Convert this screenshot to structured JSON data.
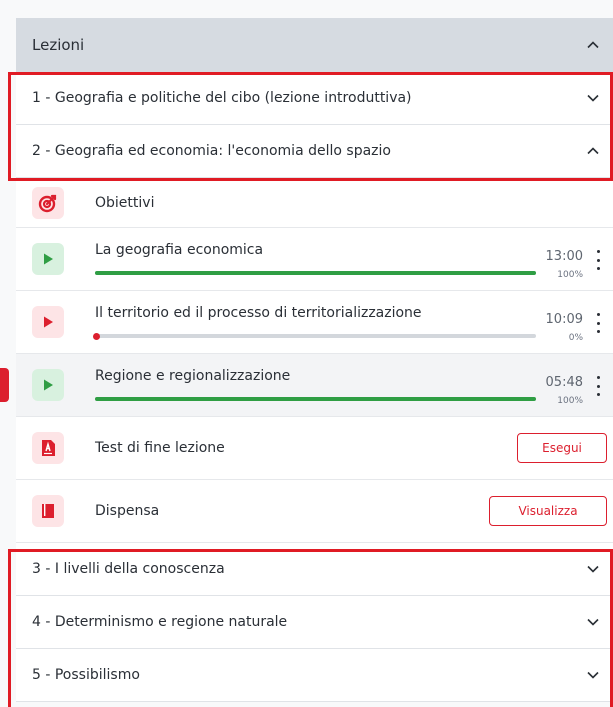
{
  "header": {
    "title": "Lezioni"
  },
  "sections": [
    {
      "label": "1 - Geografia e politiche del cibo (lezione introduttiva)",
      "expanded": false
    },
    {
      "label": "2 - Geografia ed economia: l'economia dello spazio",
      "expanded": true
    },
    {
      "label": "3 - I livelli della conoscenza",
      "expanded": false
    },
    {
      "label": "4 - Determinismo e regione naturale",
      "expanded": false
    },
    {
      "label": "5 - Possibilismo",
      "expanded": false
    }
  ],
  "lesson_items": [
    {
      "label": "Obiettivi",
      "icon": "target-icon"
    },
    {
      "label": "La geografia economica",
      "icon": "play-icon",
      "duration": "13:00",
      "progress_label": "100%",
      "progress": 1.0
    },
    {
      "label": "Il territorio ed il processo di territorializzazione",
      "icon": "play-icon",
      "duration": "10:09",
      "progress_label": "0%",
      "progress": 0.0
    },
    {
      "label": "Regione e regionalizzazione",
      "icon": "play-icon",
      "duration": "05:48",
      "progress_label": "100%",
      "progress": 1.0
    },
    {
      "label": "Test di fine lezione",
      "icon": "test-icon",
      "action": "Esegui"
    },
    {
      "label": "Dispensa",
      "icon": "book-icon",
      "action": "Visualizza"
    }
  ],
  "colors": {
    "accent": "#dc1f2e",
    "success": "#2f9e44",
    "header_bg": "#d6dbe1"
  }
}
